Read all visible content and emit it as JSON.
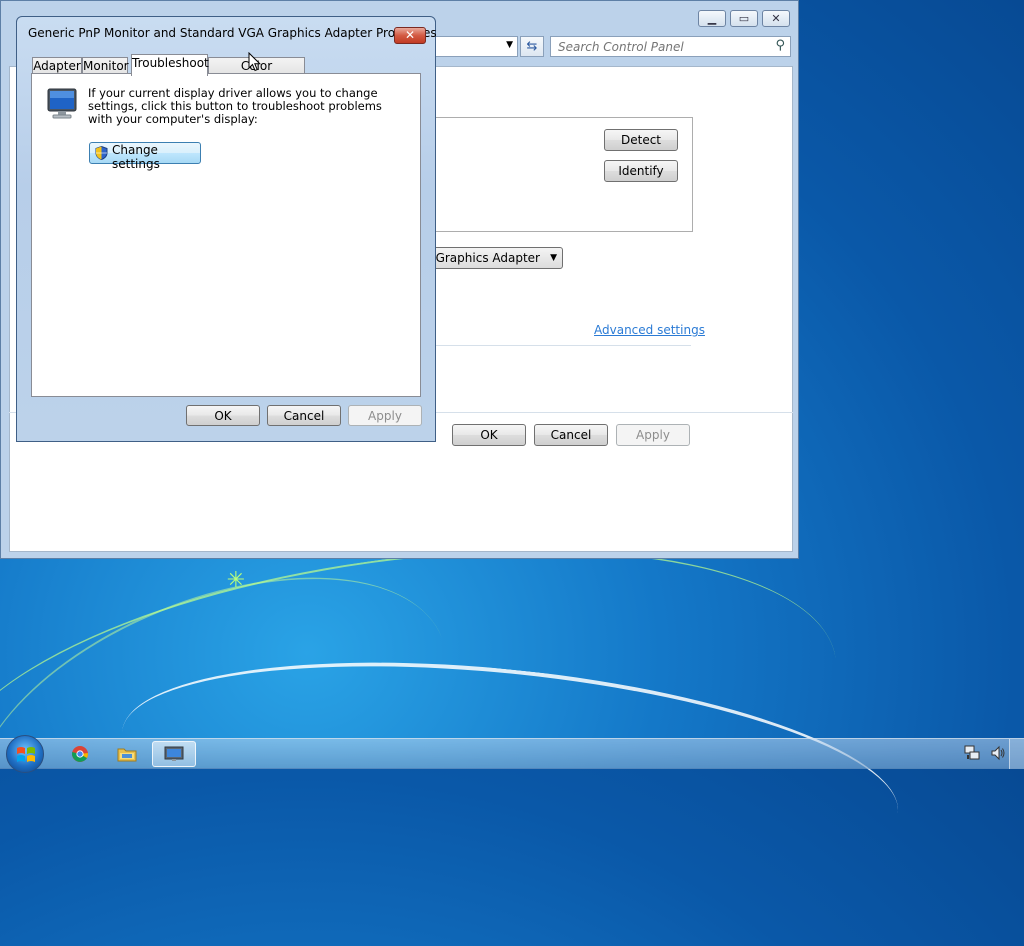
{
  "desktop": {
    "accent": "#1478c8"
  },
  "control_panel": {
    "search_placeholder": "Search Control Panel",
    "detect_label": "Detect",
    "identify_label": "Identify",
    "adapter_partial": "GA Graphics Adapter",
    "advanced_link": "Advanced settings",
    "ok_label": "OK",
    "cancel_label": "Cancel",
    "apply_label": "Apply"
  },
  "dialog": {
    "title": "Generic PnP Monitor and Standard VGA Graphics Adapter Properties",
    "close_label": "✕",
    "tabs": [
      {
        "label": "Adapter"
      },
      {
        "label": "Monitor"
      },
      {
        "label": "Troubleshoot"
      },
      {
        "label": "Color Management"
      }
    ],
    "active_tab": "Troubleshoot",
    "description": "If your current display driver allows you to change settings, click this button to troubleshoot problems with your computer's display:",
    "change_settings_label": "Change settings",
    "ok_label": "OK",
    "cancel_label": "Cancel",
    "apply_label": "Apply"
  },
  "taskbar": {
    "items": [
      {
        "icon": "chrome-icon"
      },
      {
        "icon": "file-explorer-icon"
      },
      {
        "icon": "display-settings-icon",
        "active": true
      }
    ],
    "tray": [
      {
        "icon": "network-icon"
      },
      {
        "icon": "volume-icon"
      }
    ]
  }
}
